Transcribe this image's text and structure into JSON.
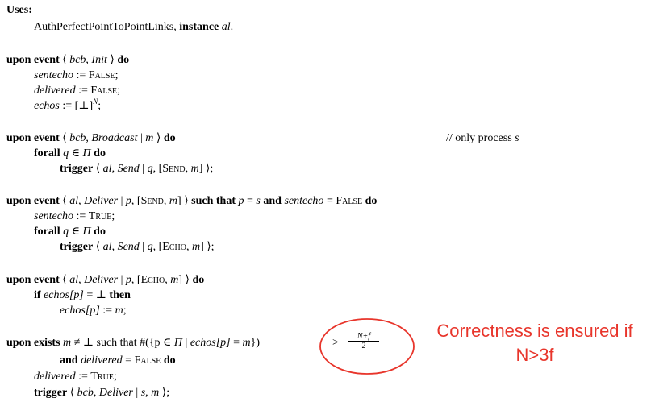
{
  "uses": {
    "header": "Uses:",
    "module": "AuthPerfectPointToPointLinks, ",
    "instance_kw": "instance",
    "instance_name": "al",
    "instance_end": "."
  },
  "init": {
    "upon": "upon event",
    "open": "⟨ ",
    "name": "bcb",
    "sep": ", ",
    "event": "Init",
    "close": " ⟩",
    "do": "do",
    "l1_var": "sentecho",
    "l1_op": " := ",
    "l1_val": "False",
    "l1_end": ";",
    "l2_var": "delivered",
    "l2_op": " := ",
    "l2_val": "False",
    "l2_end": ";",
    "l3_var": "echos",
    "l3_op": " := [⊥]",
    "l3_sup": "N",
    "l3_end": ";"
  },
  "broadcast": {
    "upon": "upon event",
    "open": "⟨ ",
    "name": "bcb",
    "sep": ", ",
    "event": "Broadcast",
    "bar": " | ",
    "arg": "m",
    "close": " ⟩",
    "do": "do",
    "comment_prefix": "// only process ",
    "comment_var": "s",
    "forall": "forall",
    "forall_q": " q",
    "forall_in": " ∈ ",
    "forall_pi": "Π",
    "forall_do": "do",
    "trigger": "trigger",
    "t_open": " ⟨ ",
    "t_al": "al",
    "t_sep": ", ",
    "t_send": "Send",
    "t_bar": " | ",
    "t_q": "q",
    "t_msg_open": ", [",
    "t_msg_kw": "Send",
    "t_msg_sep": ", ",
    "t_m": "m",
    "t_close": "] ⟩;"
  },
  "deliver_send": {
    "upon": "upon event",
    "open": "⟨ ",
    "al": "al",
    "sep": ", ",
    "event": "Deliver",
    "bar": " | ",
    "p": "p",
    "msg_open": ", [",
    "msg_kw": "Send",
    "msg_sep": ", ",
    "m": "m",
    "msg_close": "] ⟩ ",
    "such_that": "such that",
    "cond_p": " p",
    "cond_eq": " = ",
    "cond_s": "s",
    "and": " and ",
    "cond_var": "sentecho",
    "cond_eq2": " = ",
    "cond_val": "False",
    "do": " do",
    "l1_var": "sentecho",
    "l1_op": " := ",
    "l1_val": "True",
    "l1_end": ";",
    "forall": "forall",
    "forall_q": " q",
    "forall_in": " ∈ ",
    "forall_pi": "Π",
    "forall_do": "do",
    "trigger": "trigger",
    "t_open": " ⟨ ",
    "t_al": "al",
    "t_sep": ", ",
    "t_send": "Send",
    "t_bar": " | ",
    "t_q": "q",
    "t_msg_open": ", [",
    "t_msg_kw": "Echo",
    "t_msg_sep": ", ",
    "t_m": "m",
    "t_close": "] ⟩;"
  },
  "deliver_echo": {
    "upon": "upon event",
    "open": "⟨ ",
    "al": "al",
    "sep": ", ",
    "event": "Deliver",
    "bar": " | ",
    "p": "p",
    "msg_open": ", [",
    "msg_kw": "Echo",
    "msg_sep": ", ",
    "m": "m",
    "msg_close": "] ⟩ ",
    "do": "do",
    "if": "if",
    "if_var": " echos",
    "if_idx": "[p]",
    "if_eq": " = ⊥ ",
    "then": "then",
    "asg_var": "echos",
    "asg_idx": "[p]",
    "asg_op": " := ",
    "asg_m": "m",
    "asg_end": ";"
  },
  "exists": {
    "upon_exists": "upon exists",
    "cond1": " m ≠ ⊥ ",
    "such_that": "such that",
    "count_open": " #({p ∈ ",
    "pi": "Π",
    "count_bar": " | ",
    "count_var": "echos",
    "count_idx": "[p]",
    "count_eq": " = ",
    "count_m": "m",
    "count_close": "})",
    "gt": ">",
    "frac_num": "N+f",
    "frac_den": "2",
    "and": "and",
    "and_var": " delivered",
    "and_eq": " = ",
    "and_val": "False",
    "and_do": " do",
    "l1_var": "delivered",
    "l1_op": " := ",
    "l1_val": "True",
    "l1_end": ";",
    "trigger": "trigger",
    "t_open": " ⟨ ",
    "t_bcb": "bcb",
    "t_sep": ", ",
    "t_deliver": "Deliver",
    "t_bar": " | ",
    "t_s": "s",
    "t_comma": ", ",
    "t_m": "m",
    "t_close": " ⟩;"
  },
  "annotation": {
    "line1": "Correctness is ensured if",
    "line2": "N>3f",
    "color": "#e8352b"
  }
}
